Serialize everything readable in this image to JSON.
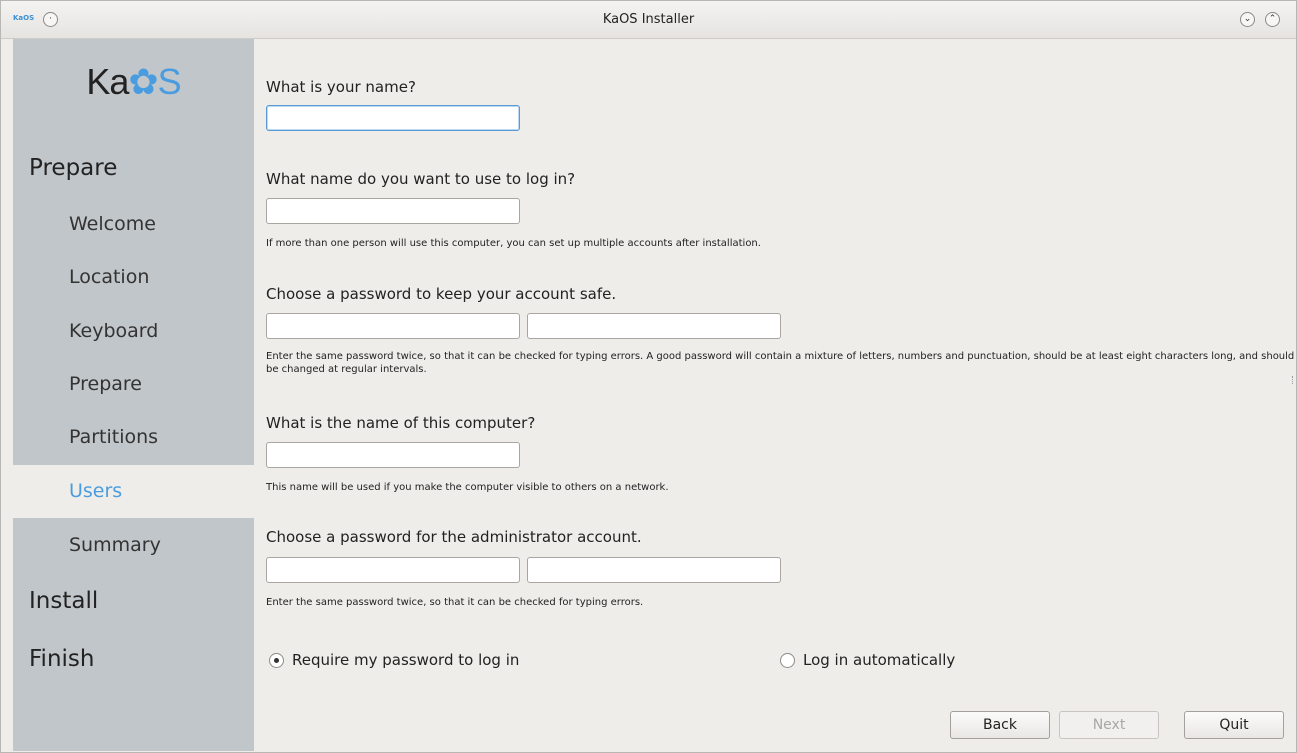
{
  "window": {
    "title": "KaOS Installer",
    "app_icon_text": "KaOS"
  },
  "sidebar": {
    "logo": {
      "ka": "Ka",
      "gear": "✿",
      "s": "S"
    },
    "sections": {
      "prepare": "Prepare",
      "install": "Install",
      "finish": "Finish"
    },
    "steps": [
      {
        "label": "Welcome",
        "active": false
      },
      {
        "label": "Location",
        "active": false
      },
      {
        "label": "Keyboard",
        "active": false
      },
      {
        "label": "Prepare",
        "active": false
      },
      {
        "label": "Partitions",
        "active": false
      },
      {
        "label": "Users",
        "active": true
      },
      {
        "label": "Summary",
        "active": false
      }
    ]
  },
  "form": {
    "name_question": "What is your name?",
    "name_value": "",
    "login_question": "What name do you want to use to log in?",
    "login_value": "",
    "login_hint": "If more than one person will use this computer, you can set up multiple accounts after installation.",
    "password_question": "Choose a password to keep your account safe.",
    "password_hint": "Enter the same password twice, so that it can be checked for typing errors. A good password will contain a mixture of letters, numbers and punctuation, should be at least eight characters long, and should be changed at regular intervals.",
    "hostname_question": "What is the name of this computer?",
    "hostname_value": "",
    "hostname_hint": "This name will be used if you make the computer visible to others on a network.",
    "admin_question": "Choose a password for the administrator account.",
    "admin_hint": "Enter the same password twice, so that it can be checked for typing errors.",
    "radio_require": "Require my password to log in",
    "radio_auto": "Log in automatically",
    "selected_radio": "require"
  },
  "buttons": {
    "back": "Back",
    "next": "Next",
    "quit": "Quit"
  },
  "colors": {
    "accent": "#4a9ce0",
    "sidebar_bg": "#c1c6ca",
    "page_bg": "#efedea"
  }
}
